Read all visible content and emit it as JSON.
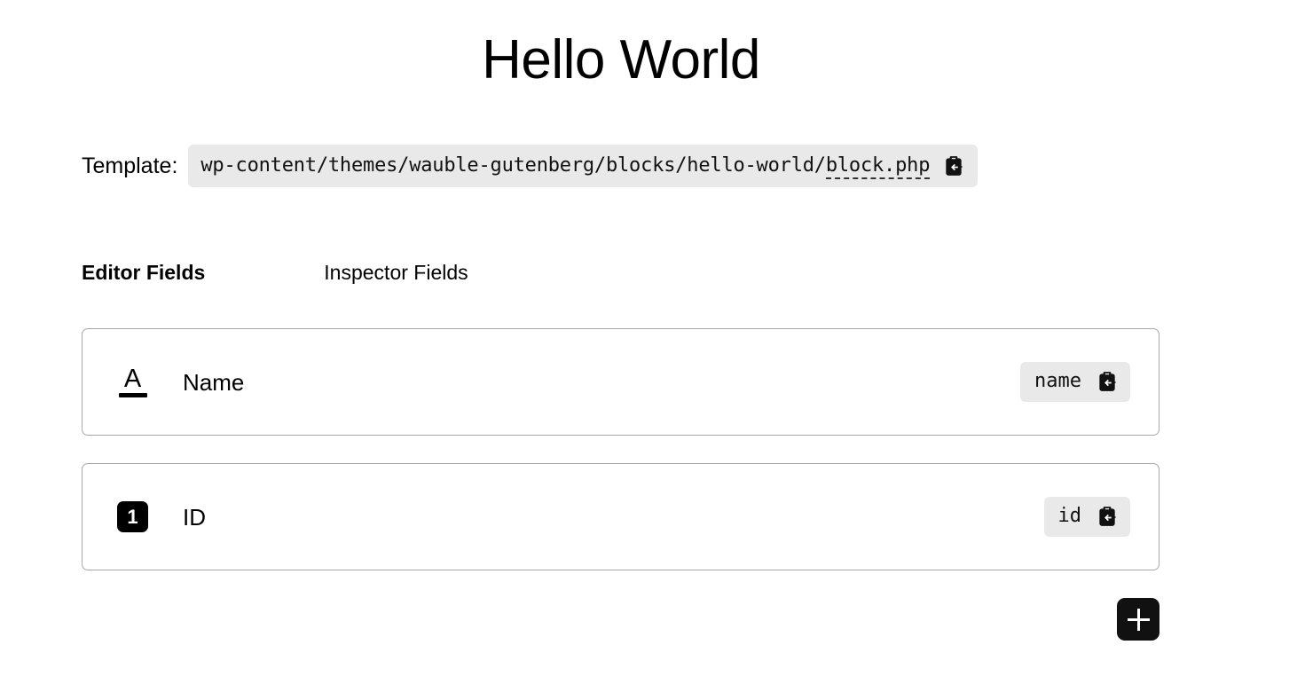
{
  "block": {
    "title": "Hello World"
  },
  "template": {
    "label": "Template:",
    "path_prefix": "wp-content/themes/wauble-gutenberg/blocks/hello-world/",
    "path_file": "block.php",
    "full_path": "wp-content/themes/wauble-gutenberg/blocks/hello-world/block.php",
    "copy_icon": "clipboard-copy-icon"
  },
  "tabs": [
    {
      "label": "Editor Fields",
      "active": true
    },
    {
      "label": "Inspector Fields",
      "active": false
    }
  ],
  "fields": [
    {
      "icon": "text-field-icon",
      "icon_glyph": "A",
      "label": "Name",
      "key": "name",
      "copy_icon": "clipboard-copy-icon"
    },
    {
      "icon": "number-field-icon",
      "icon_glyph": "1",
      "label": "ID",
      "key": "id",
      "copy_icon": "clipboard-copy-icon"
    }
  ],
  "add_button": {
    "label": "+",
    "icon": "plus-icon"
  },
  "colors": {
    "background": "#ffffff",
    "text": "#000000",
    "pill_background": "#e9e9e9",
    "card_border": "#a8a8a8",
    "button_background": "#111111",
    "button_foreground": "#ffffff"
  }
}
